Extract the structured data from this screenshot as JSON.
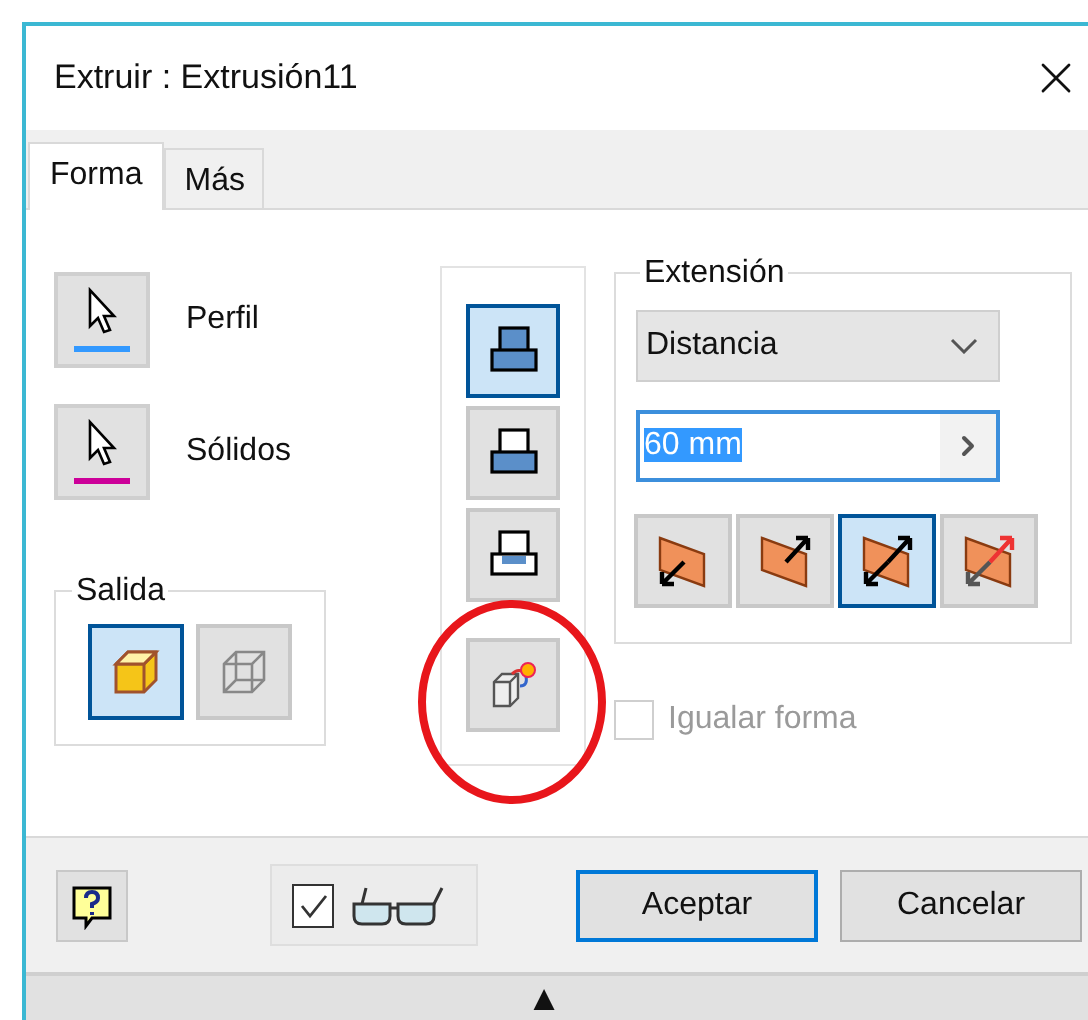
{
  "window": {
    "title": "Extruir : Extrusión11"
  },
  "tabs": [
    {
      "label": "Forma",
      "selected": true
    },
    {
      "label": "Más",
      "selected": false
    }
  ],
  "selectors": [
    {
      "label": "Perfil",
      "color": "#3399ff"
    },
    {
      "label": "Sólidos",
      "color": "#cc0099"
    }
  ],
  "output": {
    "legend": "Salida",
    "options": [
      {
        "kind": "solid",
        "selected": true
      },
      {
        "kind": "surface",
        "selected": false
      }
    ]
  },
  "operations": [
    {
      "kind": "join",
      "selected": true
    },
    {
      "kind": "cut",
      "selected": false
    },
    {
      "kind": "intersect",
      "selected": false
    },
    {
      "kind": "new_solid",
      "selected": false
    }
  ],
  "extent": {
    "legend": "Extensión",
    "type": "Distancia",
    "distance": "60 mm",
    "directions": [
      {
        "kind": "default",
        "selected": false
      },
      {
        "kind": "flipped",
        "selected": false
      },
      {
        "kind": "symmetric",
        "selected": true
      },
      {
        "kind": "asymmetric",
        "selected": false
      }
    ]
  },
  "match_shape": {
    "label": "Igualar forma",
    "checked": false,
    "disabled": true
  },
  "preview": {
    "checked": true
  },
  "buttons": [
    {
      "label": "Aceptar",
      "default": true
    },
    {
      "label": "Cancelar",
      "default": false
    }
  ],
  "expand_toggle": "▲"
}
